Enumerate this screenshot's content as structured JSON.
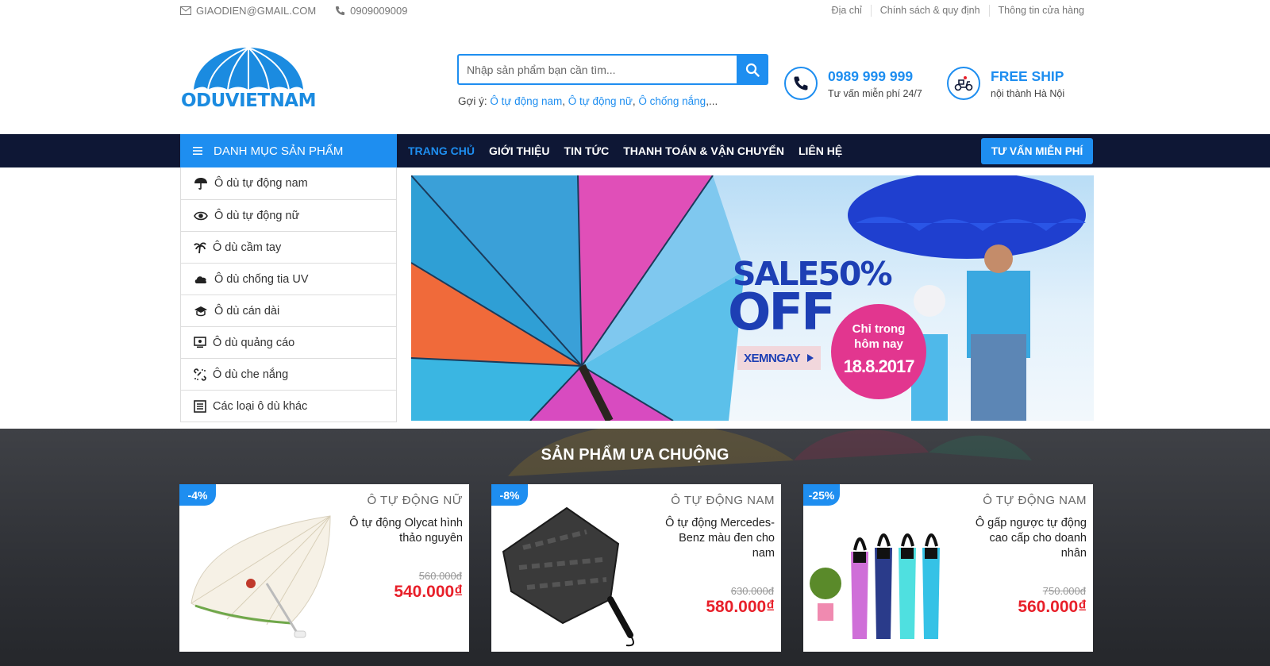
{
  "topbar": {
    "email": "GIAODIEN@GMAIL.COM",
    "phone": "0909009009",
    "links": [
      "Địa chỉ",
      "Chính sách & quy định",
      "Thông tin cửa hàng"
    ]
  },
  "logo": {
    "text": "ODUVIETNAM"
  },
  "search": {
    "placeholder": "Nhập sản phẩm bạn cần tìm...",
    "suggest_label": "Gợi ý:",
    "suggest_links": [
      "Ô tự động nam",
      "Ô tự động nữ",
      "Ô chống nắng"
    ],
    "suggest_tail": ",..."
  },
  "hotline": {
    "number": "0989 999 999",
    "sub": "Tư vấn miễn phí 24/7"
  },
  "freeship": {
    "title": "FREE SHIP",
    "sub": "nội thành Hà Nội"
  },
  "nav": {
    "category_title": "DANH MỤC SẢN PHẨM",
    "items": [
      "TRANG CHỦ",
      "GIỚI THIỆU",
      "TIN TỨC",
      "THANH TOÁN & VẬN CHUYỂN",
      "LIÊN HỆ"
    ],
    "active": "TRANG CHỦ",
    "cta": "TƯ VẤN MIỄN PHÍ"
  },
  "categories": [
    {
      "label": "Ô dù tự động nam",
      "icon": "umbrella-icon"
    },
    {
      "label": "Ô dù tự động nữ",
      "icon": "eye-icon"
    },
    {
      "label": "Ô dù cầm tay",
      "icon": "palm-tree-icon"
    },
    {
      "label": "Ô dù chống tia UV",
      "icon": "cloud-icon"
    },
    {
      "label": "Ô dù cán dài",
      "icon": "graduation-cap-icon"
    },
    {
      "label": "Ô dù quảng cáo",
      "icon": "monitor-icon"
    },
    {
      "label": "Ô dù che nắng",
      "icon": "unlink-icon"
    },
    {
      "label": "Các loại ô dù khác",
      "icon": "list-icon"
    }
  ],
  "banner": {
    "sale_line1": "SALE50%",
    "sale_line2": "OFF",
    "cta": "XEMNGAY",
    "promo_line1": "Chỉ trong",
    "promo_line2": "hôm nay",
    "promo_date": "18.8.2017"
  },
  "featured": {
    "title": "SẢN PHẨM ƯA CHUỘNG",
    "products": [
      {
        "discount": "-4%",
        "category": "Ô TỰ ĐỘNG NỮ",
        "name": "Ô tự động Olycat hình thảo nguyên",
        "old_price": "560.000đ",
        "price": "540.000₫"
      },
      {
        "discount": "-8%",
        "category": "Ô TỰ ĐỘNG NAM",
        "name": "Ô tự động Mercedes-Benz màu đen cho nam",
        "old_price": "630.000đ",
        "price": "580.000₫"
      },
      {
        "discount": "-25%",
        "category": "Ô TỰ ĐỘNG NAM",
        "name": "Ô gấp ngược tự động cao cấp cho doanh nhân",
        "old_price": "750.000đ",
        "price": "560.000₫"
      }
    ]
  },
  "colors": {
    "accent": "#1e8ef0",
    "nav_bg": "#0e1735",
    "price": "#e8202a",
    "pink": "#e2368f",
    "sale_blue": "#1d3fb4"
  }
}
